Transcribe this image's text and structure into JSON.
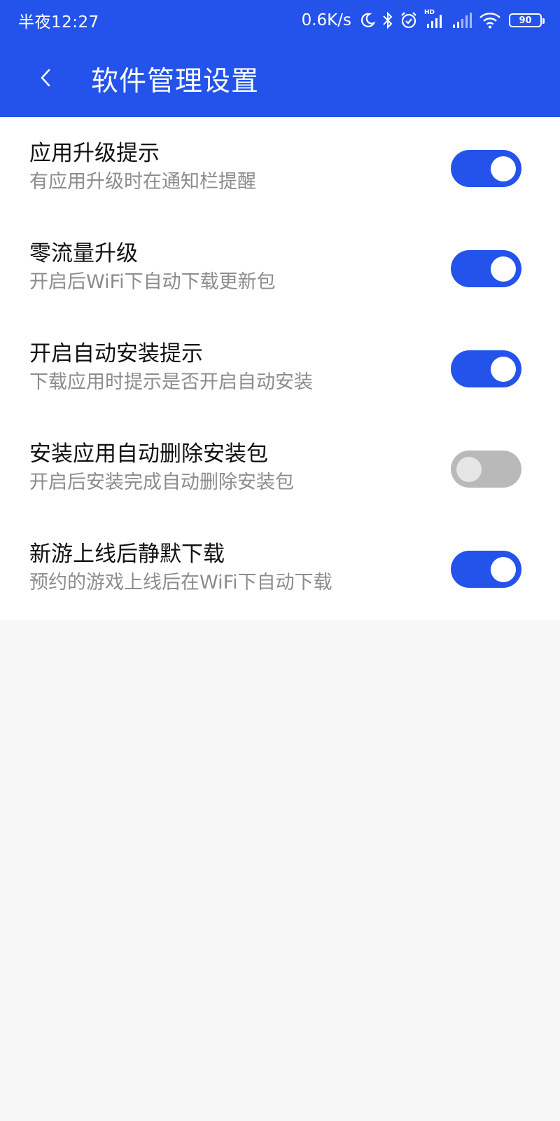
{
  "status_bar": {
    "time": "半夜12:27",
    "net_speed": "0.6K/s",
    "hd_label": "HD",
    "battery_level": "90",
    "icons": [
      "moon-icon",
      "bluetooth-icon",
      "alarm-icon",
      "signal-hd-icon",
      "signal-icon",
      "wifi-icon",
      "battery-icon"
    ]
  },
  "header": {
    "title": "软件管理设置",
    "back_icon": "chevron-left-icon"
  },
  "colors": {
    "accent": "#2353ea",
    "toggle_off": "#b9b9b9",
    "title_text": "#111111",
    "desc_text": "#8c8c8c",
    "background": "#f7f7f8"
  },
  "settings": [
    {
      "title": "应用升级提示",
      "desc": "有应用升级时在通知栏提醒",
      "enabled": true
    },
    {
      "title": "零流量升级",
      "desc": "开启后WiFi下自动下载更新包",
      "enabled": true
    },
    {
      "title": "开启自动安装提示",
      "desc": "下载应用时提示是否开启自动安装",
      "enabled": true
    },
    {
      "title": "安装应用自动删除安装包",
      "desc": "开启后安装完成自动删除安装包",
      "enabled": false
    },
    {
      "title": "新游上线后静默下载",
      "desc": "预约的游戏上线后在WiFi下自动下载",
      "enabled": true
    }
  ]
}
